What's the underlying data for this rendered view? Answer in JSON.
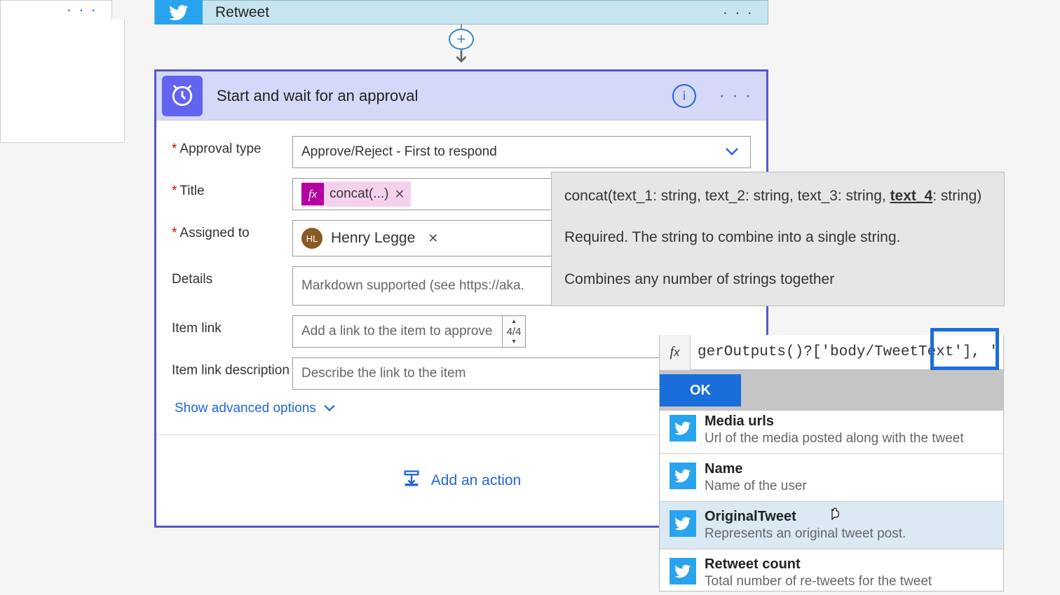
{
  "colors": {
    "primary": "#1a6edb",
    "twitter": "#2aa3ef",
    "fx": "#b4009e",
    "approval": "#6264f0"
  },
  "left_card_dots": "· · ·",
  "retweet": {
    "title": "Retweet",
    "dots": "· · ·"
  },
  "approval": {
    "title": "Start and wait for an approval",
    "info": "i",
    "dots": "· · ·",
    "fields": {
      "approval_type_label": "Approval type",
      "approval_type_value": "Approve/Reject - First to respond",
      "title_label": "Title",
      "title_chip": "concat(...)",
      "assigned_label": "Assigned to",
      "assigned_initials": "HL",
      "assigned_name": "Henry Legge",
      "details_label": "Details",
      "details_placeholder": "Markdown supported (see https://aka.",
      "item_link_label": "Item link",
      "item_link_placeholder": "Add a link to the item to approve",
      "item_link_count": "4/4",
      "item_link_desc_label": "Item link description",
      "item_link_desc_placeholder": "Describe the link to the item"
    },
    "show_advanced": "Show advanced options",
    "add_action": "Add an action"
  },
  "tooltip": {
    "sig_prefix": "concat(text_1: string, text_2: string, text_3: string, ",
    "sig_current": "text_4",
    "sig_suffix": ": string)",
    "required": "Required. The string to combine into a single string.",
    "description": "Combines any number of strings together"
  },
  "expression": {
    "fx": "fx",
    "value": "gerOutputs()?['body/TweetText'], ' ',",
    "ok": "OK"
  },
  "dynamic_content": [
    {
      "title": "Media urls",
      "desc": "Url of the media posted along with the tweet"
    },
    {
      "title": "Name",
      "desc": "Name of the user"
    },
    {
      "title": "OriginalTweet",
      "desc": "Represents an original tweet post."
    },
    {
      "title": "Retweet count",
      "desc": "Total number of re-tweets for the tweet"
    }
  ]
}
